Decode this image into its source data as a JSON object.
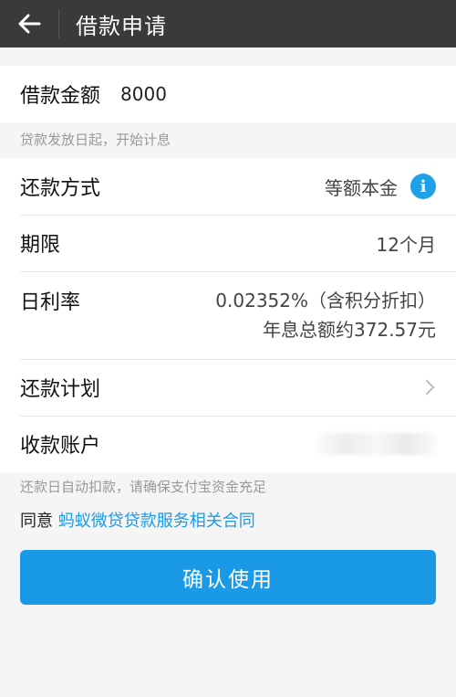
{
  "header": {
    "title": "借款申请"
  },
  "amount": {
    "label": "借款金额",
    "value": "8000",
    "hint": "贷款发放日起，开始计息"
  },
  "details": {
    "repay_method": {
      "label": "还款方式",
      "value": "等额本金"
    },
    "term": {
      "label": "期限",
      "value": "12个月"
    },
    "daily_rate": {
      "label": "日利率",
      "value": "0.02352%（含积分折扣）",
      "annual_interest": "年息总额约372.57元"
    },
    "repay_plan": {
      "label": "还款计划"
    },
    "account": {
      "label": "收款账户"
    }
  },
  "auto_debit_hint": "还款日自动扣款，请确保支付宝资金充足",
  "agreement": {
    "prefix": "同意",
    "link": "蚂蚁微贷贷款服务相关合同"
  },
  "confirm_button": "确认使用",
  "colors": {
    "topbar": "#3a3a3a",
    "accent": "#1a9ae6",
    "background": "#f5f5f5"
  }
}
